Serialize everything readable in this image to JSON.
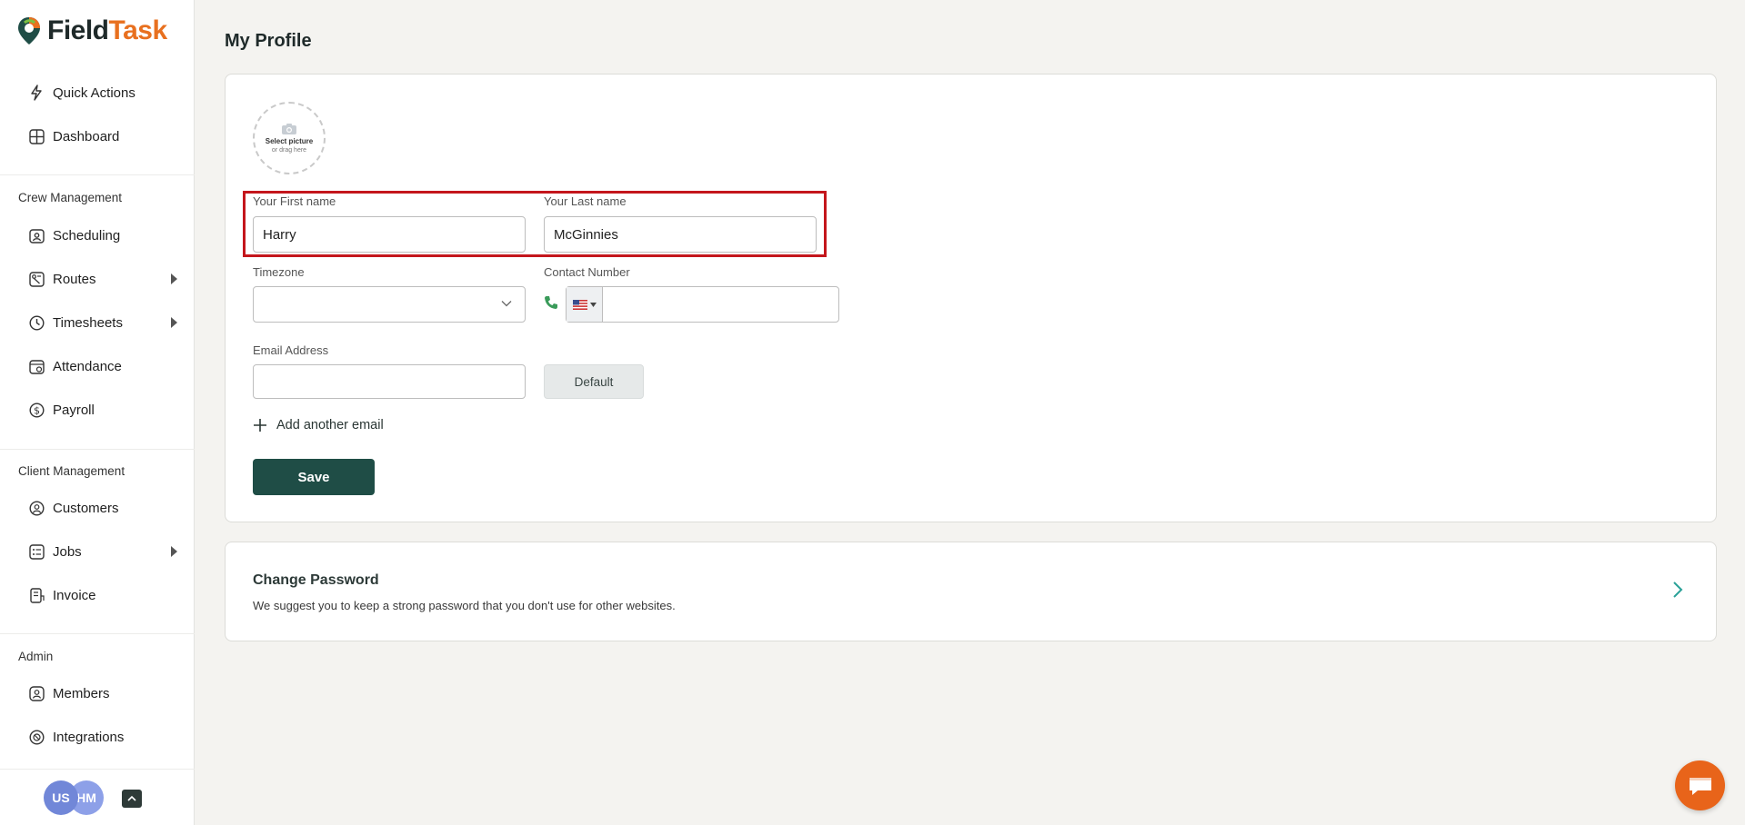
{
  "brand": {
    "name_part1": "Field",
    "name_part2": "Task",
    "accent_color": "#e8701f"
  },
  "sidebar": {
    "top_items": [
      {
        "label": "Quick Actions",
        "icon": "lightning-icon"
      },
      {
        "label": "Dashboard",
        "icon": "dashboard-icon"
      }
    ],
    "crew_title": "Crew Management",
    "crew_items": [
      {
        "label": "Scheduling",
        "icon": "calendar-person-icon"
      },
      {
        "label": "Routes",
        "icon": "routes-icon"
      },
      {
        "label": "Timesheets",
        "icon": "clock-icon"
      },
      {
        "label": "Attendance",
        "icon": "calendar-check-icon"
      },
      {
        "label": "Payroll",
        "icon": "dollar-icon"
      }
    ],
    "client_title": "Client Management",
    "client_items": [
      {
        "label": "Customers",
        "icon": "customer-icon"
      },
      {
        "label": "Jobs",
        "icon": "jobs-icon"
      },
      {
        "label": "Invoice",
        "icon": "invoice-icon"
      }
    ],
    "admin_title": "Admin",
    "admin_items": [
      {
        "label": "Members",
        "icon": "member-icon"
      },
      {
        "label": "Integrations",
        "icon": "integrations-icon"
      }
    ],
    "avatars": [
      "US",
      "HM"
    ]
  },
  "page": {
    "title": "My Profile"
  },
  "profile": {
    "picture_line1": "Select picture",
    "picture_line2": "or drag here",
    "first_name_label": "Your First name",
    "first_name_value": "Harry",
    "last_name_label": "Your Last name",
    "last_name_value": "McGinnies",
    "timezone_label": "Timezone",
    "timezone_value": "",
    "contact_label": "Contact Number",
    "contact_value": "",
    "email_label": "Email Address",
    "email_value": "",
    "default_label": "Default",
    "add_email_label": "Add another email",
    "save_label": "Save"
  },
  "change_password": {
    "title": "Change Password",
    "subtitle": "We suggest you to keep a strong password that you don't use for other websites."
  }
}
